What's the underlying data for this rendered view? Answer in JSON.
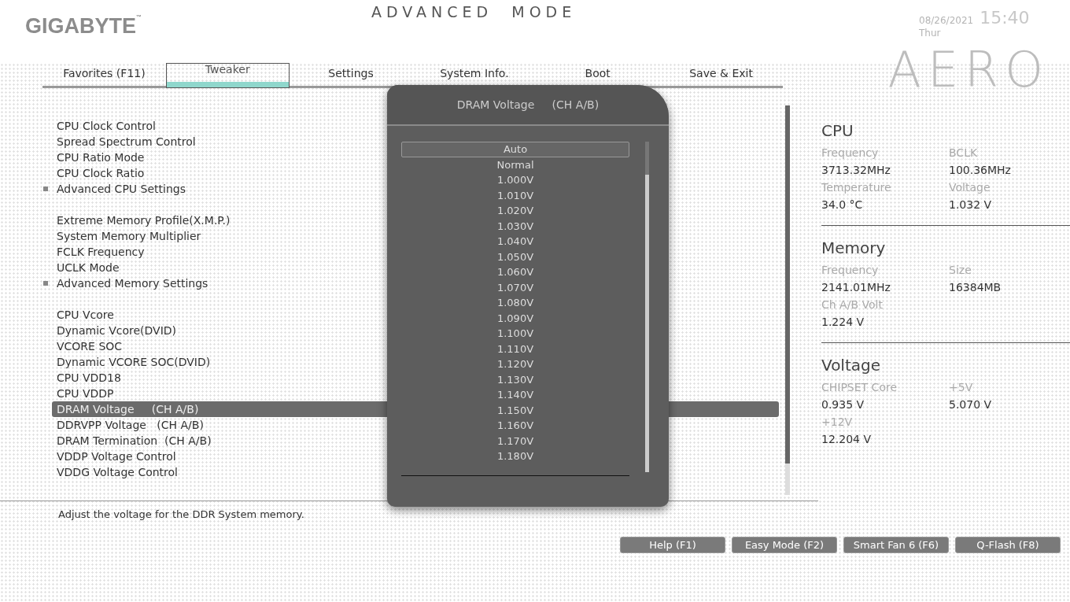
{
  "header": {
    "brand": "GIGABYTE",
    "brand_mark": "™",
    "mode_title": "ADVANCED  MODE",
    "date": "08/26/2021",
    "day": "Thur",
    "time": "15:40",
    "logo": "AERO"
  },
  "tabs": [
    {
      "label": "Favorites (F11)",
      "selected": false
    },
    {
      "label": "Tweaker",
      "selected": true
    },
    {
      "label": "Settings",
      "selected": false
    },
    {
      "label": "System Info.",
      "selected": false
    },
    {
      "label": "Boot",
      "selected": false
    },
    {
      "label": "Save & Exit",
      "selected": false
    }
  ],
  "menu_groups": [
    [
      {
        "label": "CPU Clock Control",
        "submenu": false,
        "selected": false
      },
      {
        "label": "Spread Spectrum Control",
        "submenu": false,
        "selected": false
      },
      {
        "label": "CPU Ratio Mode",
        "submenu": false,
        "selected": false
      },
      {
        "label": "CPU Clock Ratio",
        "submenu": false,
        "selected": false
      },
      {
        "label": "Advanced CPU Settings",
        "submenu": true,
        "selected": false
      }
    ],
    [
      {
        "label": "Extreme Memory Profile(X.M.P.)",
        "submenu": false,
        "selected": false
      },
      {
        "label": "System Memory Multiplier",
        "submenu": false,
        "selected": false
      },
      {
        "label": "FCLK Frequency",
        "submenu": false,
        "selected": false
      },
      {
        "label": "UCLK Mode",
        "submenu": false,
        "selected": false
      },
      {
        "label": "Advanced Memory Settings",
        "submenu": true,
        "selected": false
      }
    ],
    [
      {
        "label": "CPU Vcore",
        "submenu": false,
        "selected": false
      },
      {
        "label": "Dynamic Vcore(DVID)",
        "submenu": false,
        "selected": false
      },
      {
        "label": "VCORE SOC",
        "submenu": false,
        "selected": false
      },
      {
        "label": "Dynamic VCORE SOC(DVID)",
        "submenu": false,
        "selected": false
      },
      {
        "label": "CPU VDD18",
        "submenu": false,
        "selected": false
      },
      {
        "label": "CPU VDDP",
        "submenu": false,
        "selected": false
      },
      {
        "label": "DRAM Voltage     (CH A/B)",
        "submenu": false,
        "selected": true
      },
      {
        "label": "DDRVPP Voltage   (CH A/B)",
        "submenu": false,
        "selected": false
      },
      {
        "label": "DRAM Termination  (CH A/B)",
        "submenu": false,
        "selected": false
      },
      {
        "label": "VDDP Voltage Control",
        "submenu": false,
        "selected": false
      },
      {
        "label": "VDDG Voltage Control",
        "submenu": false,
        "selected": false
      }
    ]
  ],
  "popup": {
    "title": "DRAM Voltage     (CH A/B)",
    "options": [
      {
        "label": "Auto",
        "selected": true
      },
      {
        "label": "Normal",
        "selected": false
      },
      {
        "label": "1.000V",
        "selected": false
      },
      {
        "label": "1.010V",
        "selected": false
      },
      {
        "label": "1.020V",
        "selected": false
      },
      {
        "label": "1.030V",
        "selected": false
      },
      {
        "label": "1.040V",
        "selected": false
      },
      {
        "label": "1.050V",
        "selected": false
      },
      {
        "label": "1.060V",
        "selected": false
      },
      {
        "label": "1.070V",
        "selected": false
      },
      {
        "label": "1.080V",
        "selected": false
      },
      {
        "label": "1.090V",
        "selected": false
      },
      {
        "label": "1.100V",
        "selected": false
      },
      {
        "label": "1.110V",
        "selected": false
      },
      {
        "label": "1.120V",
        "selected": false
      },
      {
        "label": "1.130V",
        "selected": false
      },
      {
        "label": "1.140V",
        "selected": false
      },
      {
        "label": "1.150V",
        "selected": false
      },
      {
        "label": "1.160V",
        "selected": false
      },
      {
        "label": "1.170V",
        "selected": false
      },
      {
        "label": "1.180V",
        "selected": false
      }
    ]
  },
  "info_sections": [
    {
      "title": "CPU",
      "fields": [
        {
          "label": "Frequency",
          "value": "3713.32MHz"
        },
        {
          "label": "BCLK",
          "value": "100.36MHz"
        },
        {
          "label": "Temperature",
          "value": "34.0 °C"
        },
        {
          "label": "Voltage",
          "value": "1.032 V"
        }
      ]
    },
    {
      "title": "Memory",
      "fields": [
        {
          "label": "Frequency",
          "value": "2141.01MHz"
        },
        {
          "label": "Size",
          "value": "16384MB"
        },
        {
          "label": "Ch A/B Volt",
          "value": "1.224 V"
        }
      ]
    },
    {
      "title": "Voltage",
      "fields": [
        {
          "label": "CHIPSET Core",
          "value": "0.935 V"
        },
        {
          "label": "+5V",
          "value": "5.070 V"
        },
        {
          "label": "+12V",
          "value": "12.204 V"
        }
      ]
    }
  ],
  "description": "Adjust the voltage for the DDR System memory.",
  "buttons": [
    "Help (F1)",
    "Easy Mode (F2)",
    "Smart Fan 6 (F6)",
    "Q-Flash (F8)"
  ]
}
